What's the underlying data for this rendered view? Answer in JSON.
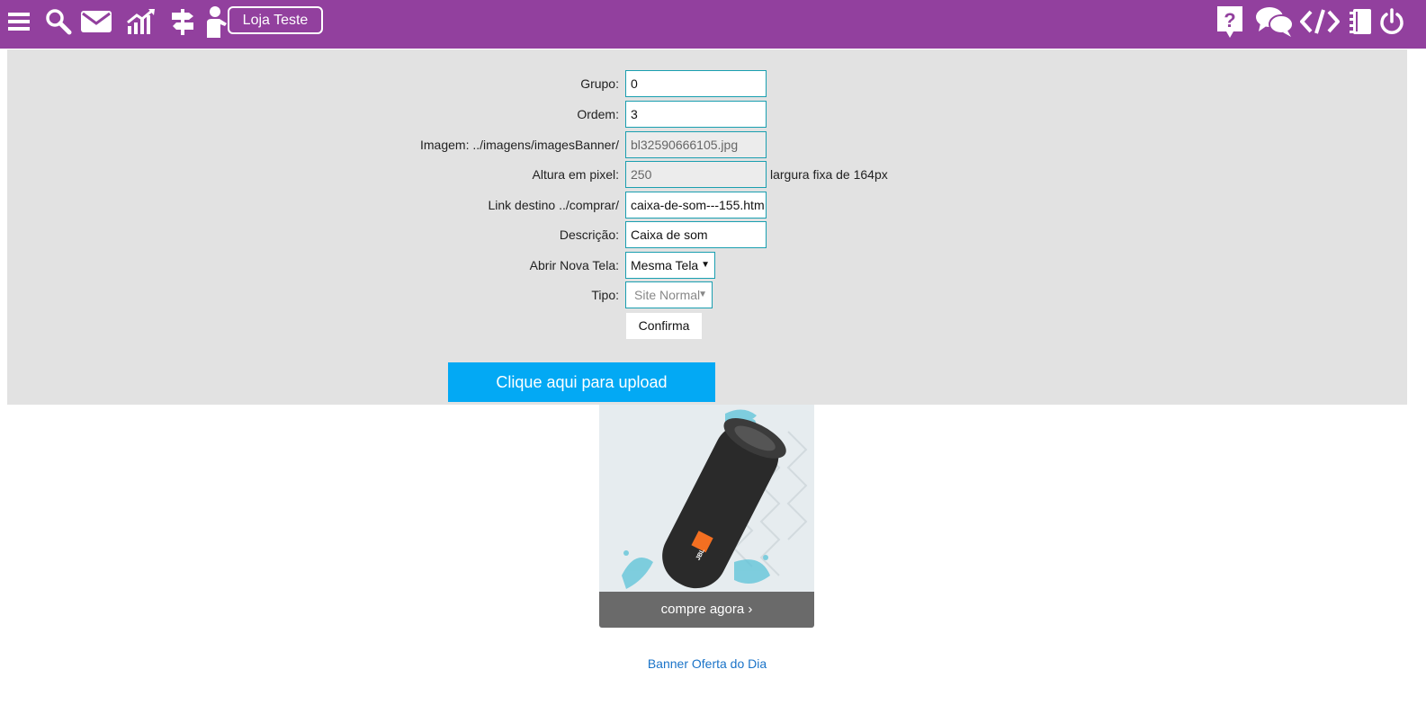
{
  "header": {
    "store_label": "Loja Teste",
    "icons": [
      "menu-icon",
      "search-icon",
      "mail-icon",
      "chart-icon",
      "signpost-icon",
      "user-icon",
      "help-icon",
      "chat-icon",
      "code-icon",
      "notebook-icon",
      "power-icon"
    ],
    "bg_color": "#92409e"
  },
  "form": {
    "grupo": {
      "label": "Grupo:",
      "value": "0"
    },
    "ordem": {
      "label": "Ordem:",
      "value": "3"
    },
    "imagem": {
      "label": "Imagem: ../imagens/imagesBanner/",
      "value": "bl32590666105.jpg"
    },
    "altura": {
      "label": "Altura em pixel:",
      "value": "250",
      "note": "largura fixa de 164px"
    },
    "link": {
      "label": "Link destino ../comprar/",
      "value": "caixa-de-som---155.htm"
    },
    "descricao": {
      "label": "Descrição:",
      "value": "Caixa de som"
    },
    "abrir": {
      "label": "Abrir Nova Tela:",
      "value": "Mesma Tela"
    },
    "tipo": {
      "label": "Tipo:",
      "value": "Site Normal"
    },
    "confirm_label": "Confirma"
  },
  "upload_label": "Clique aqui para upload",
  "upload_color": "#03a9f4",
  "banner": {
    "cta_label": "compre agora ›",
    "brand_badge": "JBL",
    "link_label": "Banner Oferta do Dia"
  }
}
